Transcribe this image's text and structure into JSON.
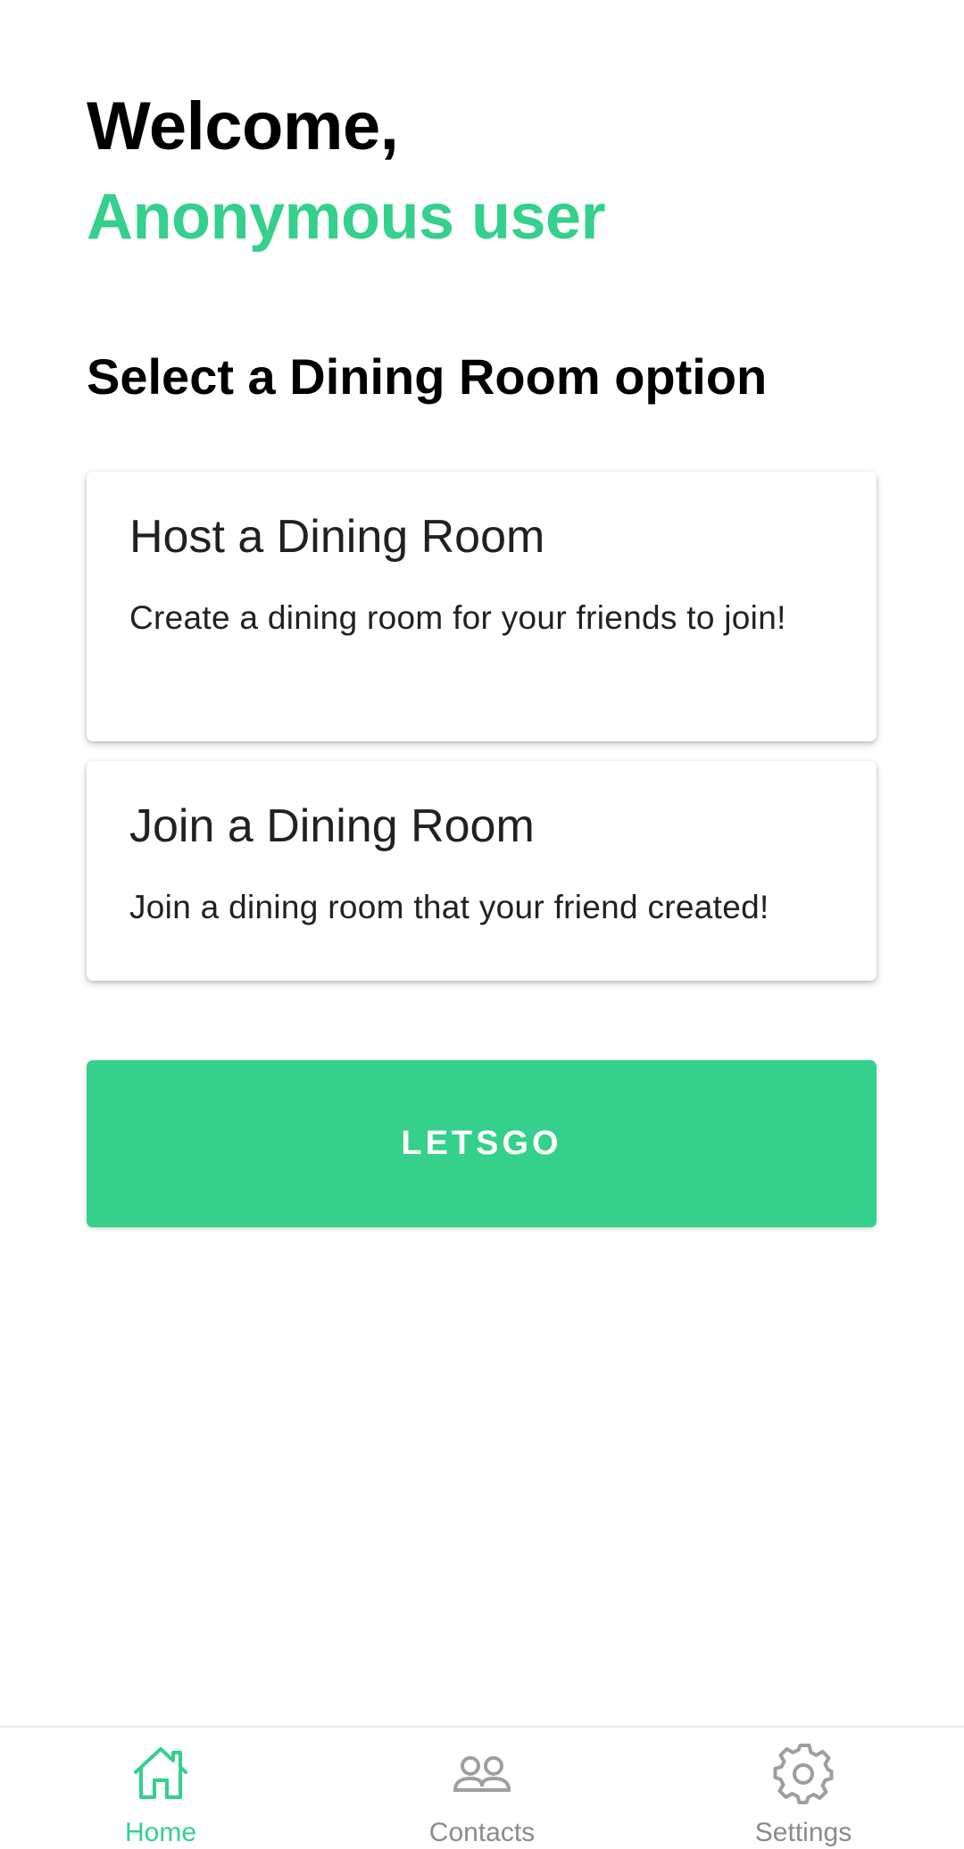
{
  "header": {
    "welcome": "Welcome,",
    "username": "Anonymous user"
  },
  "main": {
    "section_title": "Select a Dining Room option",
    "options": [
      {
        "title": "Host a Dining Room",
        "description": "Create a dining room for your friends to join!"
      },
      {
        "title": "Join a Dining Room",
        "description": "Join a dining room that your friend created!"
      }
    ],
    "go_button_label": "LETSGO"
  },
  "bottom_nav": {
    "items": [
      {
        "label": "Home",
        "icon": "home-icon",
        "active": true
      },
      {
        "label": "Contacts",
        "icon": "contacts-icon",
        "active": false
      },
      {
        "label": "Settings",
        "icon": "gear-icon",
        "active": false
      }
    ]
  },
  "colors": {
    "accent": "#34d08c",
    "text_primary": "#000000",
    "text_card": "#212121",
    "nav_inactive": "#8a8a8a"
  }
}
